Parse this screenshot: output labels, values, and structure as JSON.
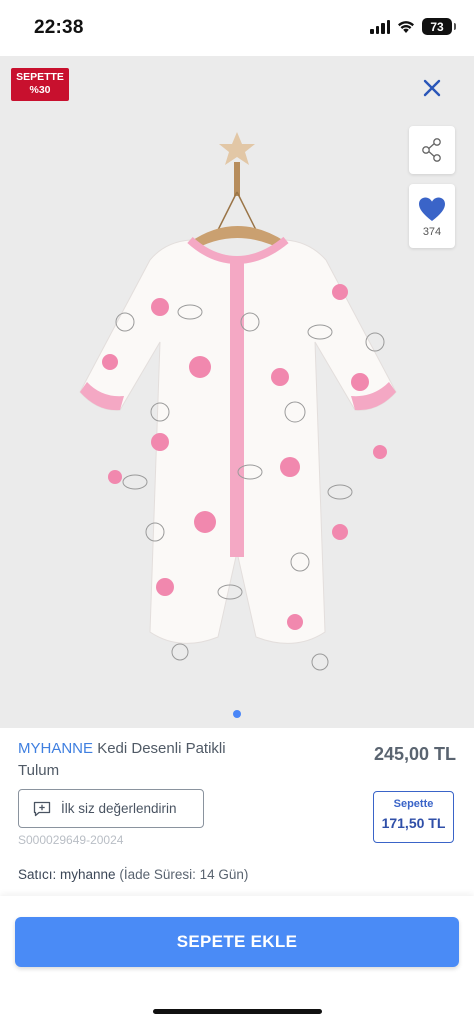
{
  "status_bar": {
    "time": "22:38",
    "battery": "73"
  },
  "gallery": {
    "discount_badge": {
      "line1": "SEPETTE",
      "line2": "%30"
    },
    "favorites_count": "374",
    "image_description_icon": "baby-romper-image",
    "page_count": 1,
    "current_page": 1
  },
  "product": {
    "brand": "MYHANNE",
    "name": "Kedi Desenli Patikli Tulum",
    "price": "245,00 TL",
    "review_button": "İlk siz değerlendirin",
    "basket_price_label": "Sepette",
    "basket_price": "171,50 TL",
    "sku": "S000029649-20024",
    "seller_label": "Satıcı:",
    "seller_name": "myhanne",
    "return_info": "(İade Süresi: 14 Gün)"
  },
  "actions": {
    "add_to_cart": "SEPETE EKLE"
  },
  "colors": {
    "accent": "#4a8bf6",
    "badge": "#c8102e",
    "brand_text": "#3f7fe0",
    "basket_border": "#3a64c8"
  }
}
